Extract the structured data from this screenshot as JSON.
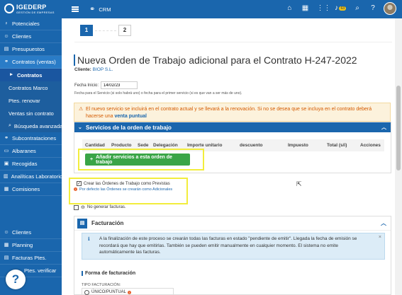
{
  "logo": {
    "name": "IGEDERP",
    "sub": "GESTIÓN DE EMPRESAS"
  },
  "sidebar": {
    "items": [
      {
        "label": "Potenciales",
        "icon": "lightbulb-icon"
      },
      {
        "label": "Clientes",
        "icon": "user-plus-icon"
      },
      {
        "label": "Presupuestos",
        "icon": "clipboard-icon"
      },
      {
        "label": "Contratos (ventas)",
        "icon": "handshake-icon"
      },
      {
        "label": "Contratos",
        "icon": "caret-right-icon"
      },
      {
        "label": "Contratos Marco"
      },
      {
        "label": "Ptes. renovar"
      },
      {
        "label": "Ventas sin contrato"
      },
      {
        "label": "Búsqueda avanzada",
        "icon": "search-icon"
      },
      {
        "label": "Subcontrataciones",
        "icon": "handshake-icon"
      },
      {
        "label": "Albaranes",
        "icon": "document-icon"
      },
      {
        "label": "Recogidas",
        "icon": "box-icon"
      },
      {
        "label": "Analíticas Laboratorio",
        "icon": "chart-icon"
      },
      {
        "label": "Comisiones",
        "icon": "table-icon"
      }
    ],
    "bottom": [
      {
        "label": "Clientes",
        "icon": "user-plus-icon"
      },
      {
        "label": "Planning",
        "icon": "calendar-icon"
      },
      {
        "label": "Facturas Ptes.",
        "icon": "invoice-icon"
      },
      {
        "label": "Ptes. verificar",
        "icon": "check-icon"
      }
    ],
    "help": "?"
  },
  "topbar": {
    "app": "CRM",
    "notif_count": "63"
  },
  "steps": [
    "1",
    "2"
  ],
  "page": {
    "title": "Nueva Orden de Trabajo adicional para el Contrato H-247-2022",
    "client_label": "Cliente:",
    "client_value": "BIOP S.L.",
    "fecha_label": "Fecha Inicio:",
    "fecha_value": "14/02/23",
    "fecha_hint": "Fecha para el Servicio (si solo habrá uno) o fecha para el primer servicio (si es que van a ser más de uno)."
  },
  "alert": {
    "text": "El nuevo servicio se incluirá en el contrato actual y se llevará a la renovación. Si no se desea que se incluya en el contrato deberá hacerse una",
    "link": "venta puntual"
  },
  "services": {
    "title": "Servicios de la orden de trabajo",
    "columns": [
      "Cantidad",
      "Producto",
      "Sede",
      "Delegación",
      "Importe unitario",
      "descuento",
      "Impuesto",
      "Total (s/i)",
      "Acciones"
    ],
    "add_button": "Añadir servicios a esta orden de trabajo"
  },
  "options": {
    "crear_label": "Crear las Órdenes de Trabajo como Previstas",
    "crear_info": "Por defecto las Órdenes se crearán como Adicionales",
    "no_facturas": "No generar facturas."
  },
  "facturacion": {
    "title": "Facturación",
    "info": "A la finalización de este proceso se crearán todas las facturas en estado \"pendiente de emitir\". Llegada la fecha de emisión se recordará que hay que emitirlas. También se pueden emitir manualmente en cualquier momento. El sistema no emite automáticamente las facturas.",
    "forma_title": "Forma de facturación",
    "tipo_label": "TIPO FACTURACIÓN:",
    "tipo_option": "ÚNICO/PUNTUAL"
  },
  "colors": {
    "primary": "#1a66ad",
    "success": "#3aa547",
    "warning_text": "#d45a00",
    "highlight": "#f2ed3c"
  }
}
